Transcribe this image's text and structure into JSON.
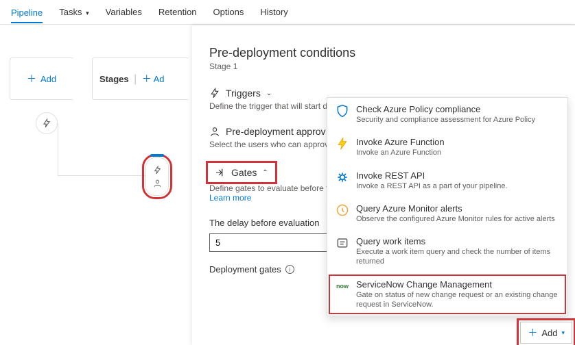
{
  "tabs": {
    "pipeline": "Pipeline",
    "tasks": "Tasks",
    "variables": "Variables",
    "retention": "Retention",
    "options": "Options",
    "history": "History"
  },
  "canvas": {
    "add": "Add",
    "stages": "Stages",
    "stages_add": "Ad"
  },
  "panel": {
    "title": "Pre-deployment conditions",
    "subtitle": "Stage 1",
    "triggers": {
      "label": "Triggers",
      "desc": "Define the trigger that will start dep"
    },
    "approvals": {
      "label": "Pre-deployment approv",
      "desc": "Select the users who can approve or"
    },
    "gates": {
      "label": "Gates",
      "desc": "Define gates to evaluate before the",
      "learn": "Learn more"
    },
    "delay": {
      "label": "The delay before evaluation",
      "value": "5"
    },
    "dep_gates": "Deployment gates",
    "add_btn": "Add"
  },
  "popup": {
    "policy": {
      "t": "Check Azure Policy compliance",
      "d": "Security and compliance assessment for Azure Policy"
    },
    "func": {
      "t": "Invoke Azure Function",
      "d": "Invoke an Azure Function"
    },
    "rest": {
      "t": "Invoke REST API",
      "d": "Invoke a REST API as a part of your pipeline."
    },
    "monitor": {
      "t": "Query Azure Monitor alerts",
      "d": "Observe the configured Azure Monitor rules for active alerts"
    },
    "work": {
      "t": "Query work items",
      "d": "Execute a work item query and check the number of items returned"
    },
    "snow": {
      "t": "ServiceNow Change Management",
      "d": "Gate on status of new change request or an existing change request in ServiceNow.",
      "icon_label": "now"
    }
  }
}
